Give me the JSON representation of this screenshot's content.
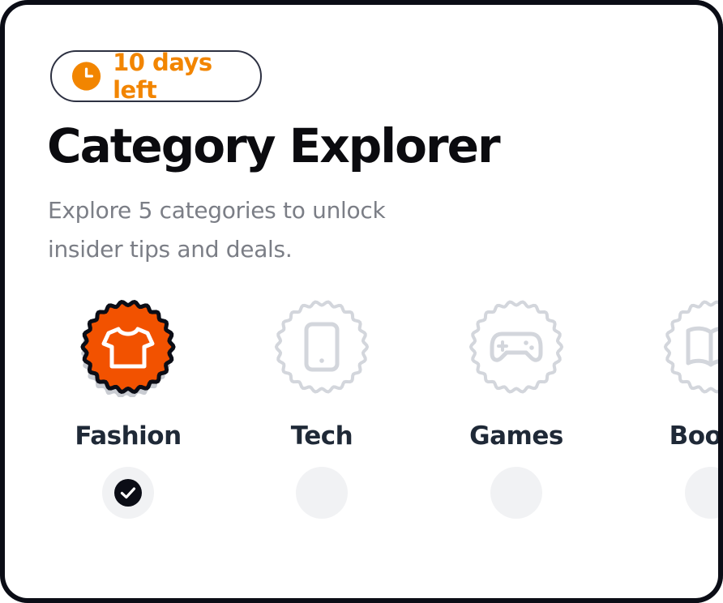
{
  "badge": {
    "icon": "clock-icon",
    "text": "10 days left",
    "color": "#f28500"
  },
  "header": {
    "title": "Category Explorer",
    "subtitle": "Explore 5 categories to unlock insider tips and deals."
  },
  "categories": [
    {
      "label": "Fashion",
      "icon": "tshirt-icon",
      "completed": true,
      "accent": "#f25200"
    },
    {
      "label": "Tech",
      "icon": "phone-icon",
      "completed": false
    },
    {
      "label": "Games",
      "icon": "gamepad-icon",
      "completed": false
    },
    {
      "label": "Books",
      "icon": "book-icon",
      "completed": false
    }
  ],
  "colors": {
    "text_dark": "#0b0b0f",
    "text_muted": "#7b7e86",
    "inactive_icon": "#cfd2d8",
    "check_bg": "#f1f2f4"
  }
}
